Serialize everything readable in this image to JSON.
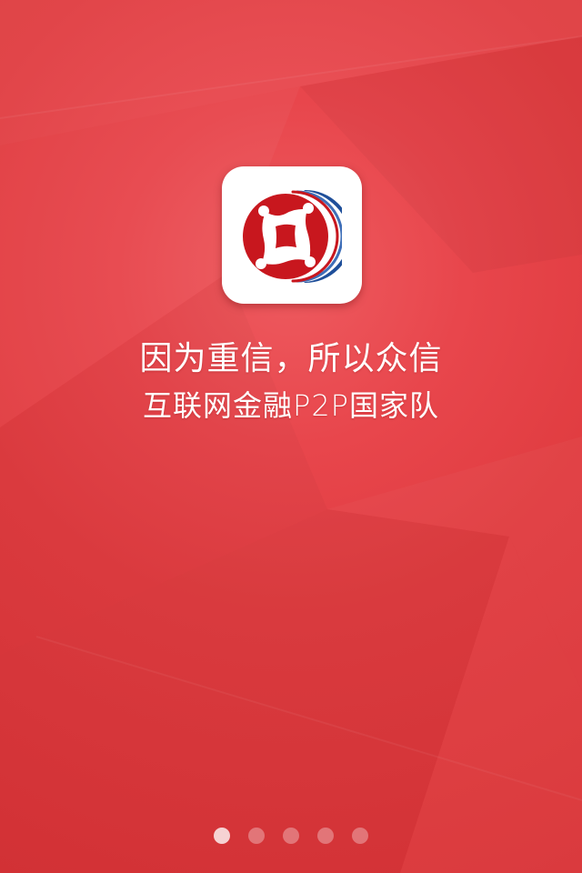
{
  "app": {
    "icon": "zhongxin-coin-logo-icon",
    "logo_red": "#c8171e",
    "logo_blue": "#1f4f9a"
  },
  "background_color": "#e2393e",
  "taglines": {
    "line1": "因为重信，所以众信",
    "line2": "互联网金融P2P国家队"
  },
  "pager": {
    "page_count": 5,
    "current_page": 1
  }
}
